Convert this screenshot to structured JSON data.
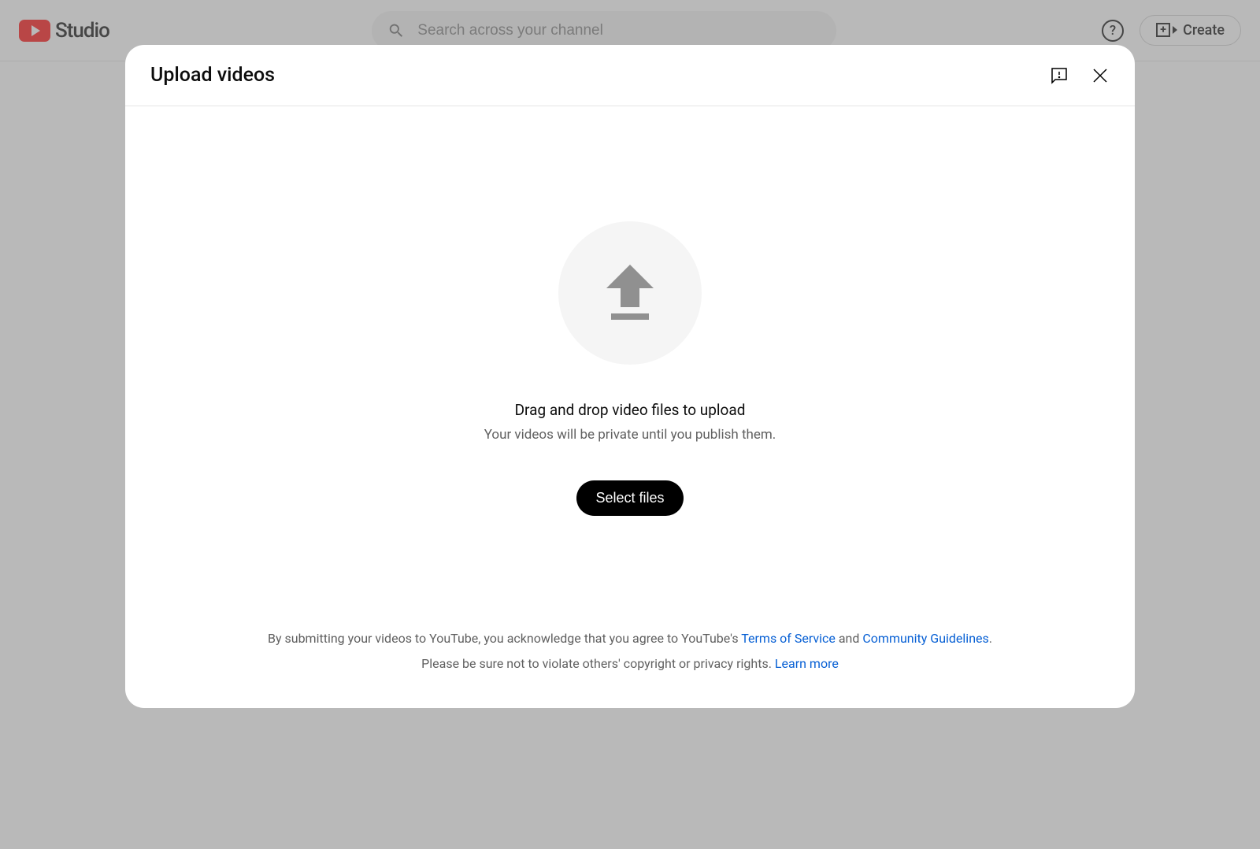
{
  "header": {
    "logo_text": "Studio",
    "search_placeholder": "Search across your channel",
    "help_label": "?",
    "create_label": "Create"
  },
  "dialog": {
    "title": "Upload videos",
    "drag_text": "Drag and drop video files to upload",
    "private_text": "Your videos will be private until you publish them.",
    "select_button": "Select files",
    "footer": {
      "prefix": "By submitting your videos to YouTube, you acknowledge that you agree to YouTube's ",
      "tos": "Terms of Service",
      "and": " and ",
      "guidelines": "Community Guidelines",
      "period": ".",
      "line2_prefix": "Please be sure not to violate others' copyright or privacy rights. ",
      "learn_more": "Learn more"
    }
  }
}
